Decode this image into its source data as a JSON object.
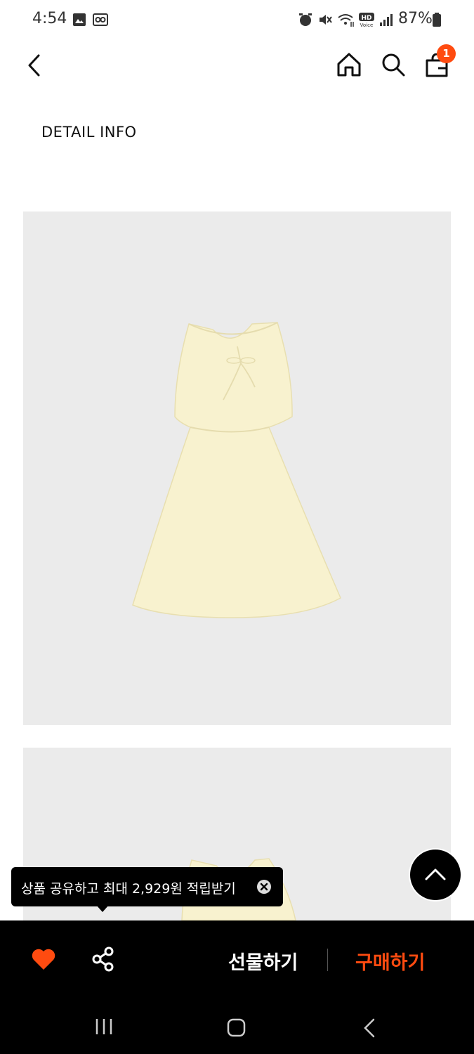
{
  "status_bar": {
    "time": "4:54",
    "battery": "87%",
    "icons": [
      "gallery-icon",
      "voicemail-icon",
      "alarm-icon",
      "mute-icon",
      "wifi-icon",
      "hd-voice-icon",
      "signal-icon",
      "battery-icon"
    ]
  },
  "header": {
    "cart_badge": "1",
    "icons": [
      "back-arrow-icon",
      "home-icon",
      "search-icon",
      "shopping-bag-icon"
    ]
  },
  "section_title": "DETAIL INFO",
  "tooltip": {
    "text": "상품 공유하고 최대 2,929원 적립받기"
  },
  "action_bar": {
    "gift_label": "선물하기",
    "buy_label": "구매하기",
    "colors": {
      "accent": "#ff4b10",
      "background": "#000000"
    }
  },
  "nav_bar": {
    "icons": [
      "recent-apps-icon",
      "home-nav-icon",
      "back-nav-icon"
    ]
  }
}
